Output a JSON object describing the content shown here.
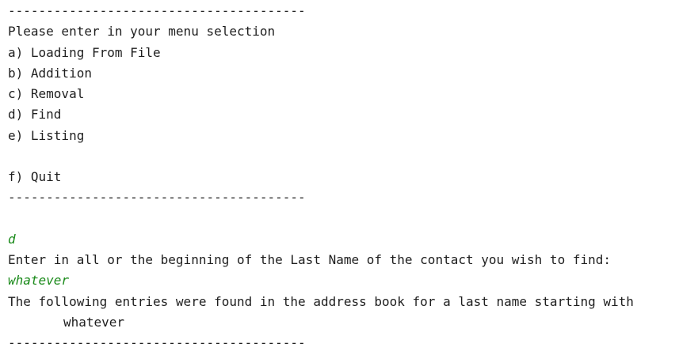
{
  "console": {
    "separator_top": "---------------------------------------",
    "menu_prompt": "Please enter in your menu selection",
    "menu_items": [
      {
        "label": "a) Loading From File"
      },
      {
        "label": "b) Addition"
      },
      {
        "label": "c) Removal"
      },
      {
        "label": "d) Find"
      },
      {
        "label": "e) Listing"
      },
      {
        "label": "f) Quit"
      }
    ],
    "separator_mid": "---------------------------------------",
    "user_choice": "d",
    "find_prompt": "Enter in all or the beginning of the Last Name of the contact you wish to find:",
    "user_query": "whatever",
    "result_text": "The following entries were found in the address book for a last name starting with",
    "result_term": "whatever",
    "separator_bottom": "---------------------------------------"
  },
  "colors": {
    "text": "#1f1f1f",
    "user_input": "#1a8a1a",
    "background": "#ffffff"
  }
}
